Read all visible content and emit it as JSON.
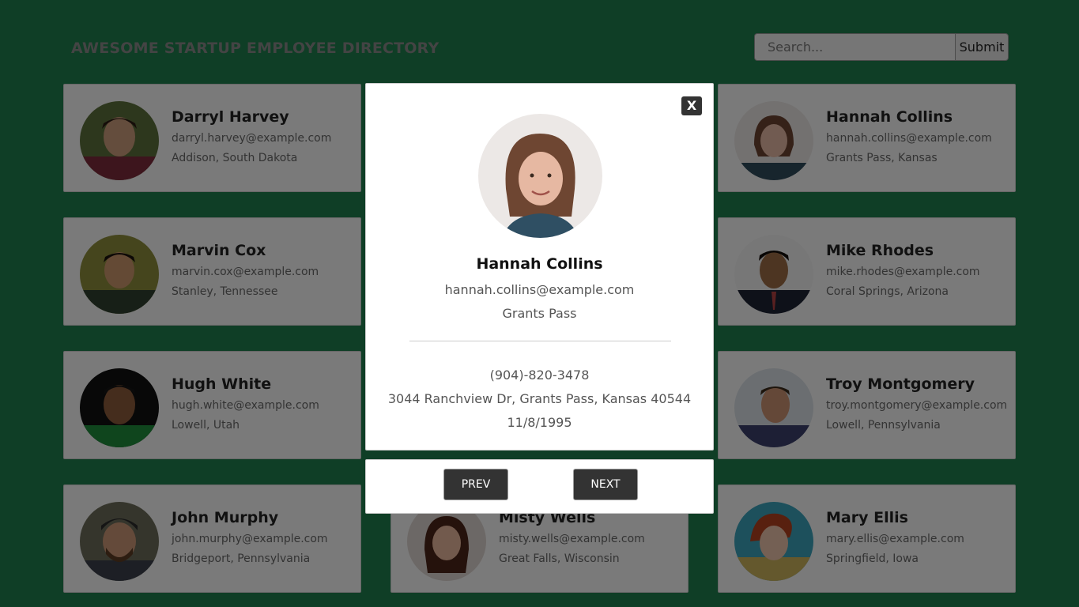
{
  "header": {
    "title": "AWESOME STARTUP EMPLOYEE DIRECTORY"
  },
  "search": {
    "placeholder": "Search...",
    "submit_label": "Submit"
  },
  "employees": [
    {
      "name": "Darryl Harvey",
      "email": "darryl.harvey@example.com",
      "location": "Addison, South Dakota"
    },
    {
      "name": "Hannah Collins",
      "email": "hannah.collins@example.com",
      "location": "Grants Pass, Kansas"
    },
    {
      "name": "Marvin Cox",
      "email": "marvin.cox@example.com",
      "location": "Stanley, Tennessee"
    },
    {
      "name": "Mike Rhodes",
      "email": "mike.rhodes@example.com",
      "location": "Coral Springs, Arizona"
    },
    {
      "name": "Hugh White",
      "email": "hugh.white@example.com",
      "location": "Lowell, Utah"
    },
    {
      "name": "Troy Montgomery",
      "email": "troy.montgomery@example.com",
      "location": "Lowell, Pennsylvania"
    },
    {
      "name": "John Murphy",
      "email": "john.murphy@example.com",
      "location": "Bridgeport, Pennsylvania"
    },
    {
      "name": "Misty Wells",
      "email": "misty.wells@example.com",
      "location": "Great Falls, Wisconsin"
    },
    {
      "name": "Mary Ellis",
      "email": "mary.ellis@example.com",
      "location": "Springfield, Iowa"
    }
  ],
  "modal": {
    "close_label": "X",
    "name": "Hannah Collins",
    "email": "hannah.collins@example.com",
    "city": "Grants Pass",
    "phone": "(904)-820-3478",
    "address": "3044 Ranchview Dr, Grants Pass, Kansas 40544",
    "birthday": "11/8/1995",
    "prev_label": "PREV",
    "next_label": "NEXT"
  },
  "colors": {
    "page_background": "#1f7d4c",
    "button_dark": "#333333"
  }
}
